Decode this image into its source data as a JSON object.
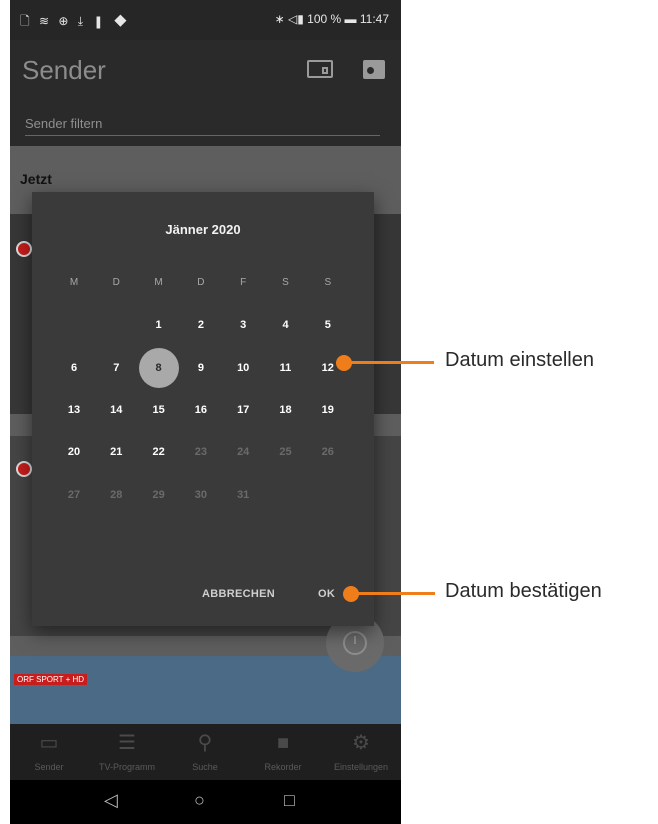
{
  "status": {
    "left_icons": "🗋 ≋ ⊕ ⤓ ▮ ◆",
    "right": "∗ ◁▮ 100 % ▬ 11:47"
  },
  "app": {
    "title": "Sender",
    "filter_placeholder": "Sender filtern",
    "section": "Jetzt",
    "icons": [
      "cast-icon",
      "radio-icon"
    ],
    "card_badge": "ORF SPORT + HD"
  },
  "dialog": {
    "month": "Jänner 2020",
    "weekdays": [
      "M",
      "D",
      "M",
      "D",
      "F",
      "S",
      "S"
    ],
    "weeks": [
      [
        null,
        null,
        1,
        2,
        3,
        4,
        5
      ],
      [
        6,
        7,
        8,
        9,
        10,
        11,
        12
      ],
      [
        13,
        14,
        15,
        16,
        17,
        18,
        19
      ],
      [
        20,
        21,
        22,
        23,
        24,
        25,
        26
      ],
      [
        27,
        28,
        29,
        30,
        31,
        null,
        null
      ]
    ],
    "selected": 8,
    "last_enabled": 22,
    "cancel_label": "ABBRECHEN",
    "ok_label": "OK"
  },
  "bottom_nav": [
    {
      "label": "Sender",
      "icon": "tv-icon"
    },
    {
      "label": "TV-Programm",
      "icon": "list-icon"
    },
    {
      "label": "Suche",
      "icon": "search-icon"
    },
    {
      "label": "Rekorder",
      "icon": "camera-icon"
    },
    {
      "label": "Einstellungen",
      "icon": "gear-icon"
    }
  ],
  "system_nav": {
    "back": "◁",
    "home": "○",
    "recents": "□"
  },
  "callouts": {
    "date_set": "Datum einstellen",
    "date_confirm": "Datum bestätigen"
  },
  "colors": {
    "accent": "#ef7d1a",
    "dialog": "#3a3a3a",
    "selected": "#a9a9a9"
  }
}
